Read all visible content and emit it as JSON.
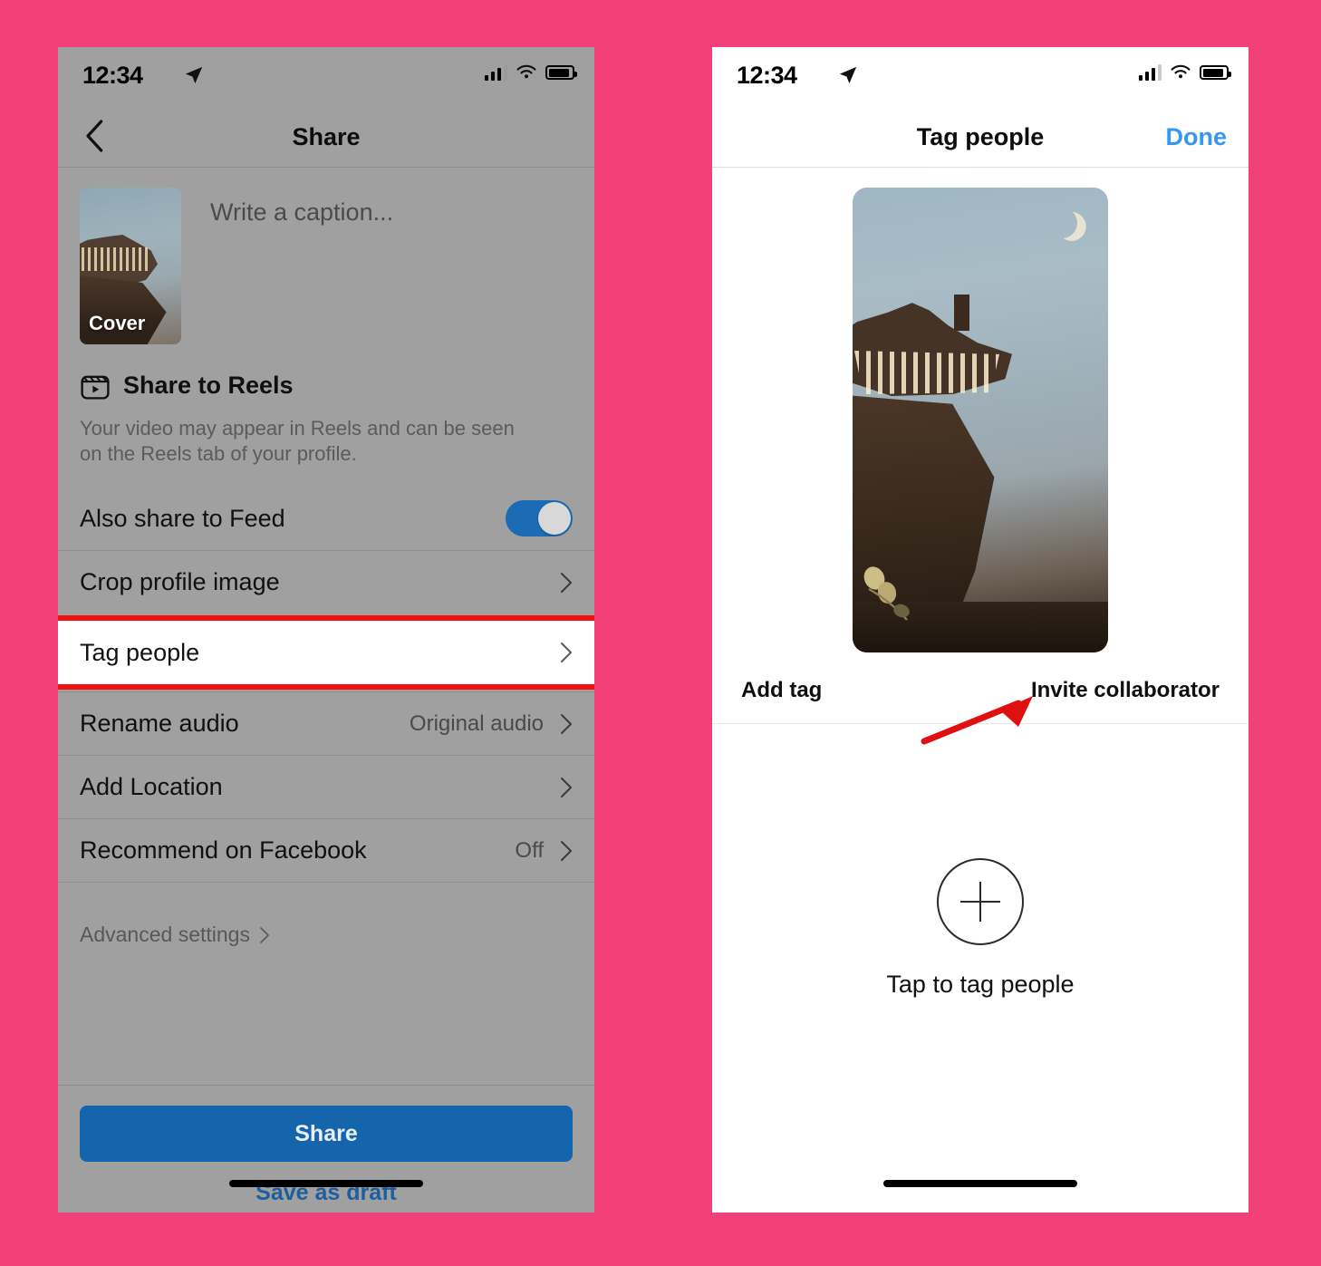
{
  "background_color": "#f2407a",
  "accent_colors": {
    "ios_blue": "#3797f0",
    "share_button": "#1565ad",
    "toggle_on": "#1b6bb5",
    "highlight_red": "#f20f0f",
    "arrow_red": "#e11010"
  },
  "left_phone": {
    "status_bar": {
      "time": "12:34",
      "location_icon": "location-arrow-icon",
      "cellular_icon": "cellular-bars-icon",
      "wifi_icon": "wifi-icon",
      "battery_icon": "battery-full-icon"
    },
    "nav": {
      "back_icon": "chevron-left-icon",
      "title": "Share"
    },
    "composer": {
      "cover_label": "Cover",
      "caption_placeholder": "Write a caption..."
    },
    "reels": {
      "icon": "reels-clapperboard-icon",
      "title": "Share to Reels",
      "description": "Your video may appear in Reels and can be seen on the Reels tab of your profile."
    },
    "rows": [
      {
        "label": "Also share to Feed",
        "control": "toggle",
        "state": "on"
      },
      {
        "label": "Crop profile image",
        "control": "chevron",
        "value": ""
      },
      {
        "label": "Tag people",
        "control": "chevron",
        "value": "",
        "highlighted": true
      },
      {
        "label": "Rename audio",
        "control": "chevron",
        "value": "Original audio"
      },
      {
        "label": "Add Location",
        "control": "chevron",
        "value": ""
      },
      {
        "label": "Recommend on Facebook",
        "control": "chevron",
        "value": "Off"
      }
    ],
    "advanced_settings": {
      "label": "Advanced settings",
      "icon": "chevron-right-icon"
    },
    "footer": {
      "share_label": "Share",
      "draft_label": "Save as draft"
    }
  },
  "right_phone": {
    "status_bar": {
      "time": "12:34",
      "location_icon": "location-arrow-icon",
      "cellular_icon": "cellular-bars-icon",
      "wifi_icon": "wifi-icon",
      "battery_icon": "battery-full-icon"
    },
    "nav": {
      "title": "Tag people",
      "done_label": "Done"
    },
    "media_preview": {
      "description": "Night photo of a lit timber-framed house on a cliff under a crescent moon"
    },
    "actions": {
      "add_tag_label": "Add tag",
      "invite_collaborator_label": "Invite collaborator"
    },
    "empty_state": {
      "plus_icon": "plus-circle-icon",
      "label": "Tap to tag people"
    }
  },
  "annotations": {
    "highlight_box_target": "Tag people",
    "arrow_target": "Invite collaborator"
  }
}
